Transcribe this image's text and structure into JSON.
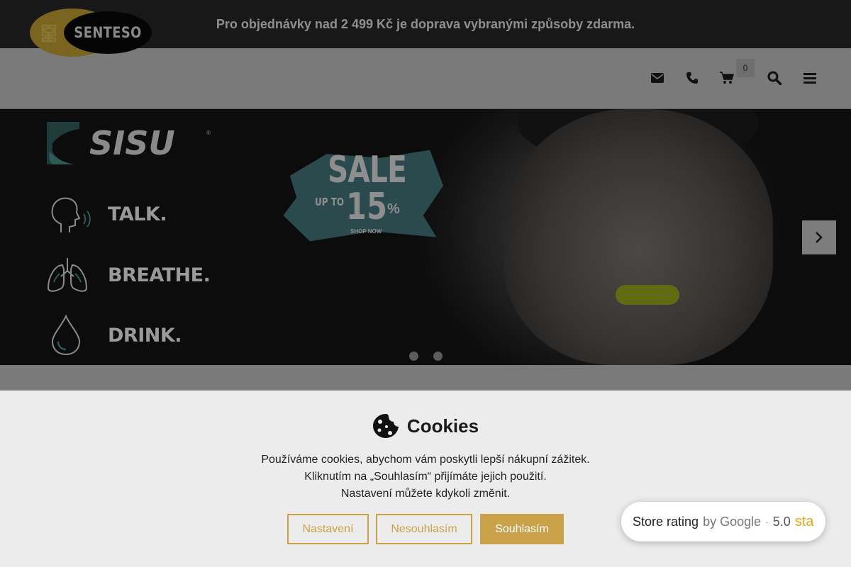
{
  "announcement": "Pro objednávky nad 2 499 Kč je doprava vybranými způsoby zdarma.",
  "header": {
    "logo_text": "SENTESO",
    "cart_count": "0"
  },
  "hero": {
    "brand": "SISU",
    "features": [
      {
        "label": "TALK."
      },
      {
        "label": "BREATHE."
      },
      {
        "label": "DRINK."
      }
    ],
    "sale": {
      "title": "SALE",
      "upto": "UP TO",
      "percent": "15",
      "percent_sign": "%",
      "cta": "SHOP NOW"
    },
    "slides_total": 2,
    "active_slide": 1
  },
  "cookie": {
    "title": "Cookies",
    "lines": [
      "Používáme cookies, abychom vám poskytli lepší nákupní zážitek.",
      "Kliknutím na „Souhlasím“ přijímáte jejich použití.",
      "Nastavení můžete kdykoli změnit."
    ],
    "buttons": {
      "settings": "Nastavení",
      "reject": "Nesouhlasím",
      "accept": "Souhlasím"
    }
  },
  "rating": {
    "label": "Store rating",
    "by": "by Google",
    "separator": "·",
    "score": "5.0",
    "stars": "sta"
  },
  "colors": {
    "accent": "#c9a24a",
    "overlay_dark": "#181818",
    "teal": "#2b4a4d"
  }
}
